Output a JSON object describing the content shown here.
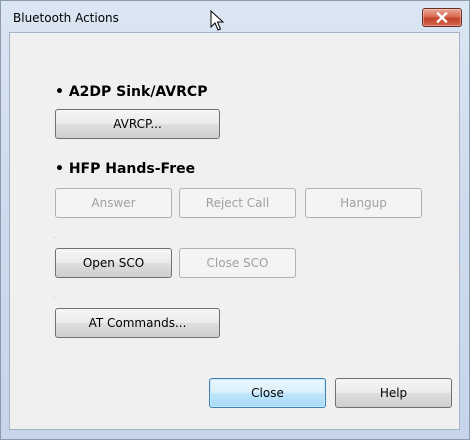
{
  "window": {
    "title": "Bluetooth Actions",
    "close_symbol": "✕"
  },
  "sections": {
    "a2dp": {
      "title": "• A2DP Sink/AVRCP",
      "avrcp_label": "AVRCP..."
    },
    "hfp": {
      "title": "• HFP Hands-Free",
      "answer_label": "Answer",
      "reject_label": "Reject Call",
      "hangup_label": "Hangup",
      "open_sco_label": "Open SCO",
      "close_sco_label": "Close SCO",
      "at_commands_label": "AT Commands..."
    }
  },
  "footer": {
    "close_label": "Close",
    "help_label": "Help"
  },
  "icons": {
    "cursor": "mouse-cursor-icon",
    "close": "close-icon"
  },
  "colors": {
    "title_close_red": "#c4432c",
    "focus_blue": "#3c7fb1",
    "disabled_text": "#a0a0a0"
  }
}
